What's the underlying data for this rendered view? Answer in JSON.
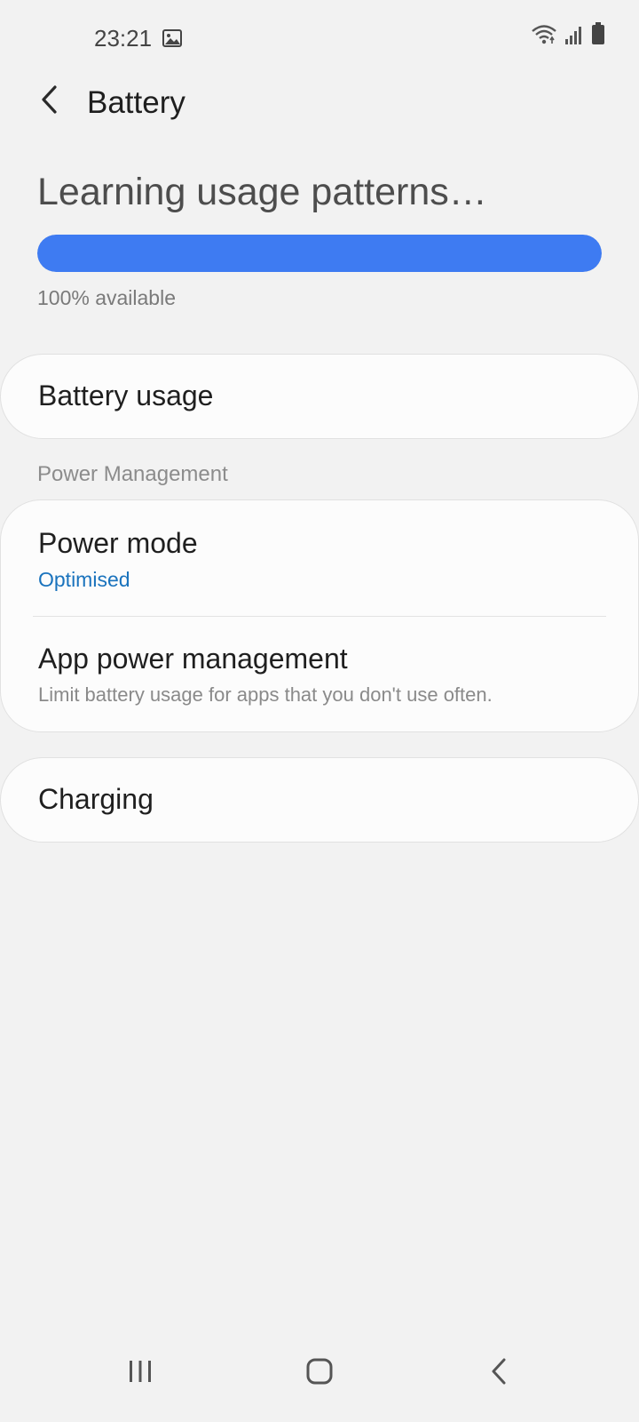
{
  "status_bar": {
    "time": "23:21",
    "icons": [
      "gallery-icon",
      "wifi-icon",
      "signal-icon",
      "battery-icon"
    ]
  },
  "header": {
    "title": "Battery",
    "back_icon": "chevron-left-icon"
  },
  "summary": {
    "title": "Learning usage patterns…",
    "level_percent": 100,
    "available_text": "100% available",
    "bar_color": "#3e7bf2"
  },
  "battery_usage": {
    "label": "Battery usage"
  },
  "power_management": {
    "header": "Power Management",
    "power_mode": {
      "title": "Power mode",
      "value": "Optimised",
      "value_color": "#1a73bd"
    },
    "app_power": {
      "title": "App power management",
      "description": "Limit battery usage for apps that you don't use often."
    }
  },
  "charging": {
    "label": "Charging"
  },
  "nav_bar": {
    "icons": [
      "recents-icon",
      "home-icon",
      "back-icon"
    ]
  }
}
